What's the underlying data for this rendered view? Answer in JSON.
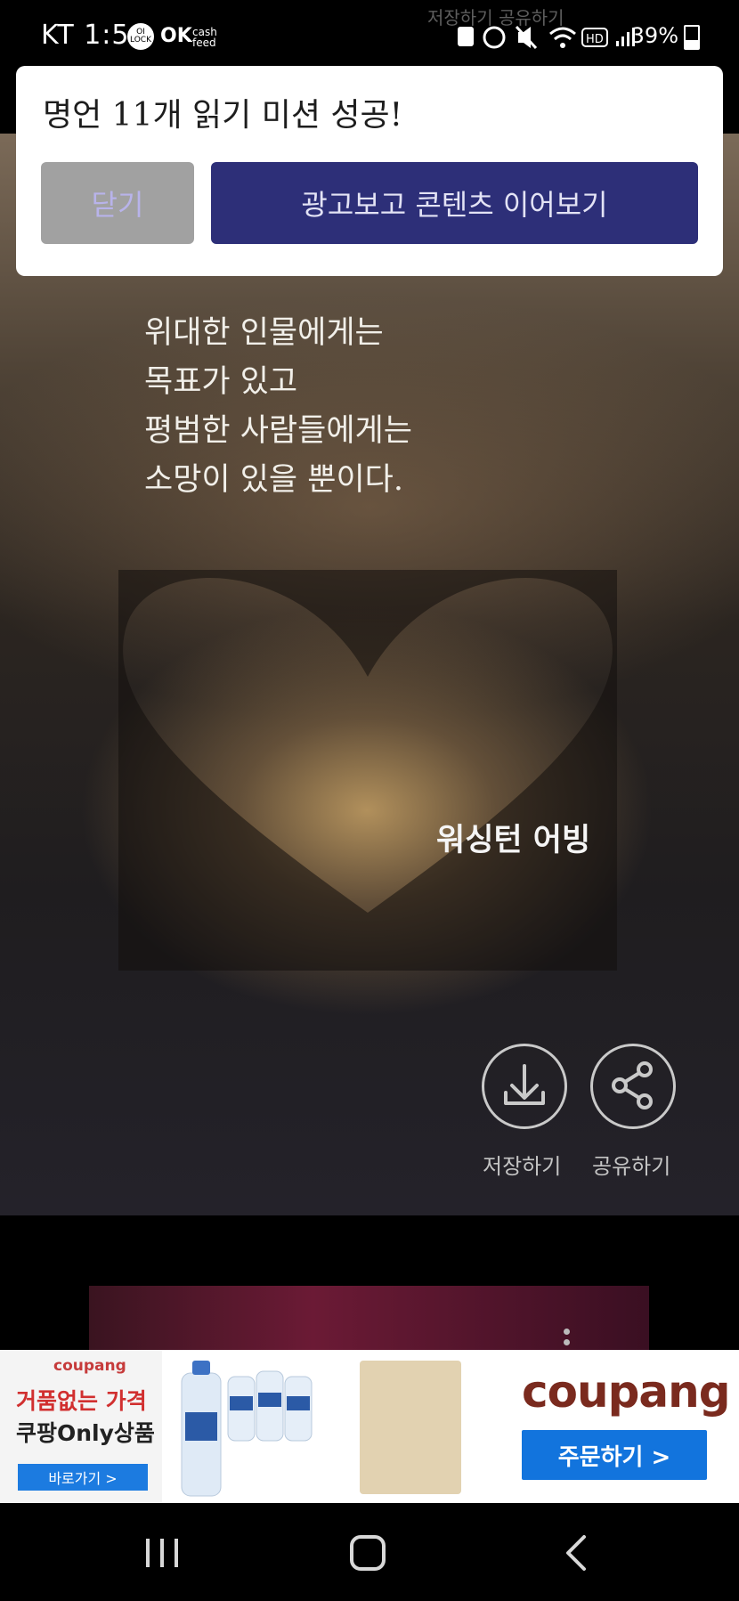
{
  "status_bar": {
    "carrier_time": "KT 1:54",
    "app_icons": [
      "OI LOCK",
      "OK",
      "cash feed"
    ],
    "hd_badge": "HD",
    "battery": "39%"
  },
  "top_faded_labels": "저장하기    공유하기",
  "dialog": {
    "title": "명언 11개 읽기 미션 성공!",
    "close_label": "닫기",
    "watch_ad_label": "광고보고 콘텐츠 이어보기"
  },
  "quote": {
    "lines": [
      "위대한 인물에게는",
      " 목표가 있고",
      " 평범한 사람들에게는",
      " 소망이 있을 뿐이다."
    ],
    "author": "워싱턴 어빙"
  },
  "actions": {
    "save_label": "저장하기",
    "share_label": "공유하기"
  },
  "ad": {
    "small_logo": "coupang",
    "headline_1": "거품없는 가격",
    "headline_2": "쿠팡Only상품",
    "go_label": "바로가기 >",
    "brand": "coupang",
    "order_label": "주문하기 >"
  },
  "colors": {
    "dialog_close_bg": "#a1a1a1",
    "dialog_primary_bg": "#2d2f78",
    "ad_blue": "#1274dd"
  }
}
